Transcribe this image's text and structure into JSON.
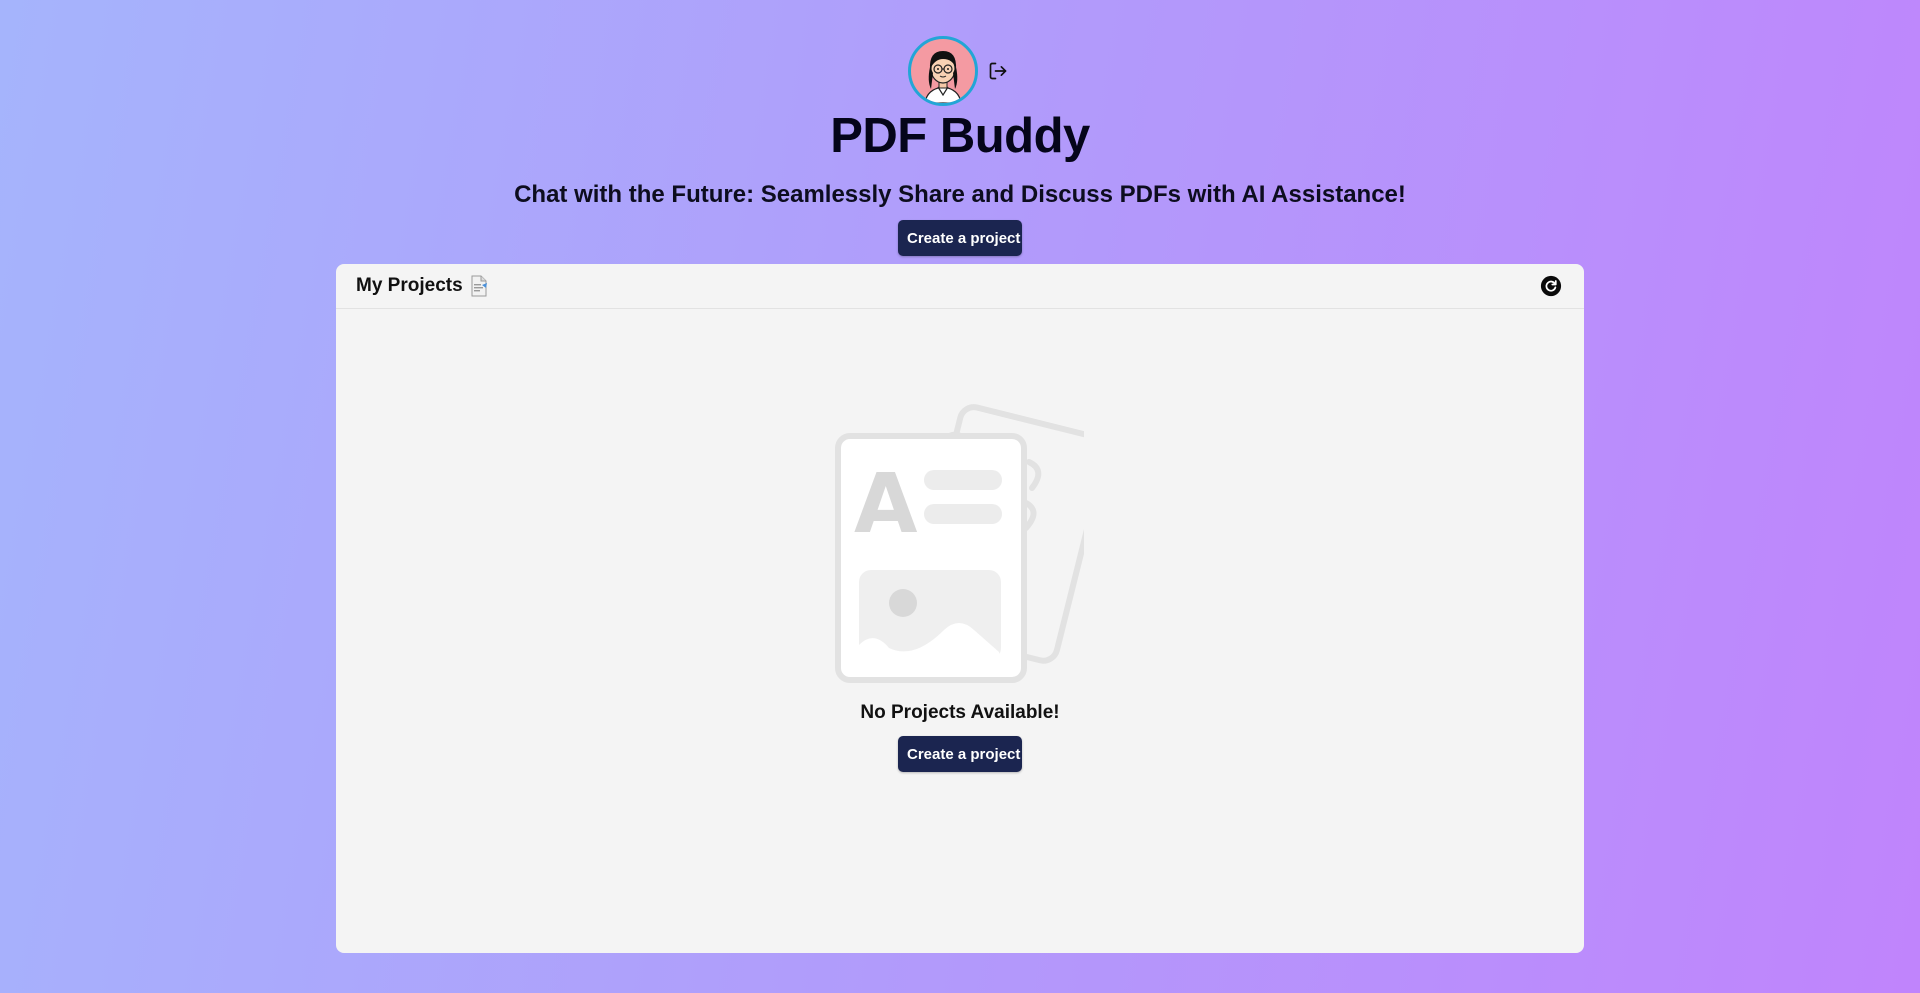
{
  "app": {
    "title": "PDF Buddy",
    "subtitle": "Chat with the Future: Seamlessly Share and Discuss PDFs with AI Assistance!"
  },
  "user": {
    "avatar_icon": "cartoon-avatar",
    "logout_icon": "logout-icon"
  },
  "header": {
    "create_label": "Create a project"
  },
  "projects": {
    "title": "My Projects",
    "title_icon": "document-emoji",
    "refresh_icon": "refresh-icon",
    "empty_message": "No Projects Available!",
    "create_label": "Create a project"
  },
  "colors": {
    "accent_button": "#1b2550",
    "avatar_border": "#22a6d6",
    "avatar_bg": "#f49aa2",
    "panel_bg": "#f4f4f4"
  }
}
